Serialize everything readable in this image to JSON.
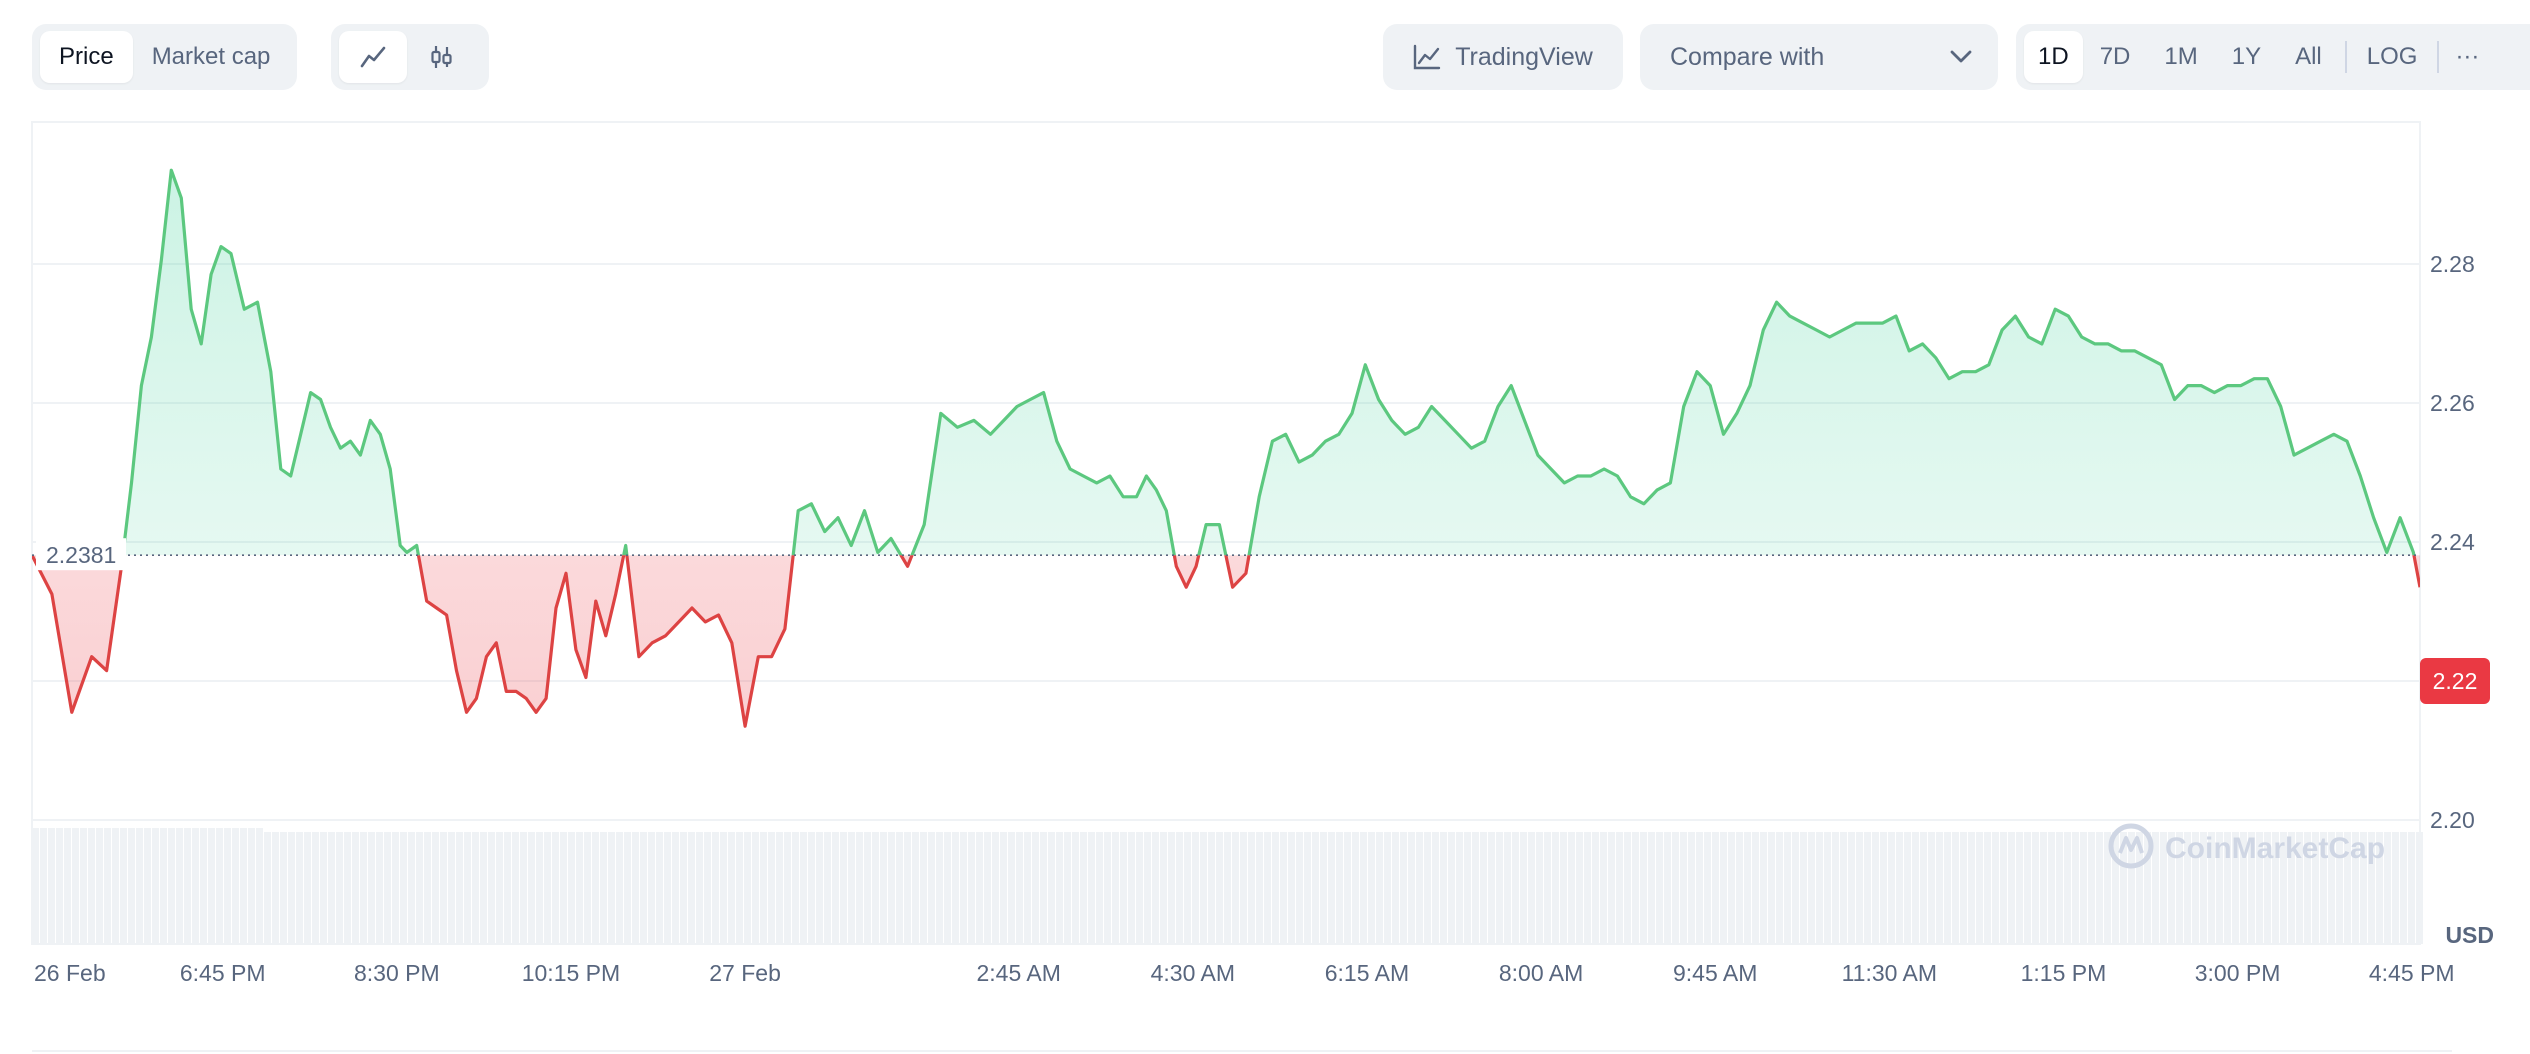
{
  "toolbar": {
    "metric_tabs": [
      "Price",
      "Market cap"
    ],
    "active_metric": "Price",
    "tradingview_label": "TradingView",
    "compare_label": "Compare with",
    "ranges": [
      "1D",
      "7D",
      "1M",
      "1Y",
      "All"
    ],
    "active_range": "1D",
    "log_label": "LOG",
    "more_label": "···"
  },
  "colors": {
    "up": "#16c784",
    "up_line": "#5cc87f",
    "down": "#ea3943",
    "down_line": "#dd4343",
    "grid": "#eff2f5",
    "text": "#58667e",
    "volume": "#eff2f5"
  },
  "watermark": "CoinMarketCap",
  "chart_data": {
    "type": "area",
    "title": "",
    "xlabel": "",
    "ylabel": "",
    "unit_label": "USD",
    "reference_value": 2.2381,
    "reference_label": "2.2381",
    "current_value": 2.22,
    "current_label": "2.22",
    "ylim": [
      2.2,
      2.3
    ],
    "y_ticks": [
      2.2,
      2.22,
      2.24,
      2.26,
      2.28
    ],
    "y_tick_labels": [
      "2.20",
      "2.22",
      "2.24",
      "2.26",
      "2.28"
    ],
    "xlim": [
      0,
      1440
    ],
    "x_tick_positions": [
      0,
      115,
      220,
      325,
      430,
      595,
      700,
      805,
      910,
      1015,
      1120,
      1225,
      1330,
      1435
    ],
    "x_tick_labels": [
      "26 Feb",
      "6:45 PM",
      "8:30 PM",
      "10:15 PM",
      "27 Feb",
      "2:45 AM",
      "4:30 AM",
      "6:15 AM",
      "8:00 AM",
      "9:45 AM",
      "11:30 AM",
      "1:15 PM",
      "3:00 PM",
      "4:45 PM"
    ],
    "grid": true,
    "x": [
      0,
      12,
      24,
      36,
      45,
      54,
      60,
      66,
      72,
      78,
      84,
      90,
      96,
      102,
      108,
      114,
      120,
      128,
      136,
      144,
      150,
      156,
      162,
      168,
      174,
      180,
      186,
      192,
      198,
      204,
      210,
      216,
      222,
      226,
      232,
      238,
      244,
      250,
      256,
      262,
      268,
      274,
      280,
      286,
      292,
      298,
      304,
      310,
      316,
      322,
      328,
      334,
      340,
      346,
      352,
      358,
      366,
      374,
      382,
      390,
      398,
      406,
      414,
      422,
      430,
      438,
      446,
      454,
      462,
      470,
      478,
      486,
      494,
      502,
      510,
      518,
      528,
      538,
      548,
      558,
      568,
      578,
      586,
      594,
      602,
      610,
      618,
      626,
      634,
      642,
      650,
      658,
      666,
      672,
      678,
      684,
      690,
      696,
      702,
      708,
      716,
      724,
      732,
      740,
      748,
      756,
      764,
      772,
      780,
      788,
      796,
      804,
      812,
      820,
      828,
      836,
      844,
      852,
      860,
      868,
      876,
      884,
      892,
      900,
      908,
      916,
      924,
      932,
      940,
      948,
      956,
      964,
      972,
      980,
      988,
      996,
      1004,
      1012,
      1020,
      1028,
      1036,
      1044,
      1052,
      1060,
      1068,
      1076,
      1084,
      1092,
      1100,
      1108,
      1116,
      1124,
      1132,
      1140,
      1148,
      1156,
      1164,
      1172,
      1180,
      1188,
      1196,
      1204,
      1212,
      1220,
      1228,
      1236,
      1244,
      1252,
      1260,
      1268,
      1276,
      1284,
      1292,
      1300,
      1308,
      1316,
      1324,
      1332,
      1340,
      1348,
      1356,
      1364,
      1372,
      1380,
      1388,
      1396,
      1404,
      1412,
      1420,
      1428,
      1436,
      1440
    ],
    "values": [
      2.2381,
      2.2325,
      2.2155,
      2.2235,
      2.2215,
      2.2365,
      2.2485,
      2.2625,
      2.2695,
      2.2805,
      2.2935,
      2.2895,
      2.2735,
      2.2685,
      2.2785,
      2.2825,
      2.2815,
      2.2735,
      2.2745,
      2.2645,
      2.2505,
      2.2495,
      2.2555,
      2.2615,
      2.2605,
      2.2565,
      2.2535,
      2.2545,
      2.2525,
      2.2575,
      2.2555,
      2.2505,
      2.2395,
      2.2385,
      2.2395,
      2.2315,
      2.2305,
      2.2295,
      2.2215,
      2.2155,
      2.2175,
      2.2235,
      2.2255,
      2.2185,
      2.2185,
      2.2175,
      2.2155,
      2.2175,
      2.2305,
      2.2355,
      2.2245,
      2.2205,
      2.2315,
      2.2265,
      2.2325,
      2.2395,
      2.2235,
      2.2255,
      2.2265,
      2.2285,
      2.2305,
      2.2285,
      2.2295,
      2.2255,
      2.2135,
      2.2235,
      2.2235,
      2.2275,
      2.2445,
      2.2455,
      2.2415,
      2.2435,
      2.2395,
      2.2445,
      2.2385,
      2.2405,
      2.2365,
      2.2425,
      2.2585,
      2.2565,
      2.2575,
      2.2555,
      2.2575,
      2.2595,
      2.2605,
      2.2615,
      2.2545,
      2.2505,
      2.2495,
      2.2485,
      2.2495,
      2.2465,
      2.2465,
      2.2495,
      2.2475,
      2.2445,
      2.2365,
      2.2335,
      2.2365,
      2.2425,
      2.2425,
      2.2335,
      2.2355,
      2.2465,
      2.2545,
      2.2555,
      2.2515,
      2.2525,
      2.2545,
      2.2555,
      2.2585,
      2.2655,
      2.2605,
      2.2575,
      2.2555,
      2.2565,
      2.2595,
      2.2575,
      2.2555,
      2.2535,
      2.2545,
      2.2595,
      2.2625,
      2.2575,
      2.2525,
      2.2505,
      2.2485,
      2.2495,
      2.2495,
      2.2505,
      2.2495,
      2.2465,
      2.2455,
      2.2475,
      2.2485,
      2.2595,
      2.2645,
      2.2625,
      2.2555,
      2.2585,
      2.2625,
      2.2705,
      2.2745,
      2.2725,
      2.2715,
      2.2705,
      2.2695,
      2.2705,
      2.2715,
      2.2715,
      2.2715,
      2.2725,
      2.2675,
      2.2685,
      2.2665,
      2.2635,
      2.2645,
      2.2645,
      2.2655,
      2.2705,
      2.2725,
      2.2695,
      2.2685,
      2.2735,
      2.2725,
      2.2695,
      2.2685,
      2.2685,
      2.2675,
      2.2675,
      2.2665,
      2.2655,
      2.2605,
      2.2625,
      2.2625,
      2.2615,
      2.2625,
      2.2625,
      2.2635,
      2.2635,
      2.2595,
      2.2525,
      2.2535,
      2.2545,
      2.2555,
      2.2545,
      2.2495,
      2.2435,
      2.2385,
      2.2435,
      2.2385,
      2.2335,
      2.2265,
      2.2265
    ]
  }
}
